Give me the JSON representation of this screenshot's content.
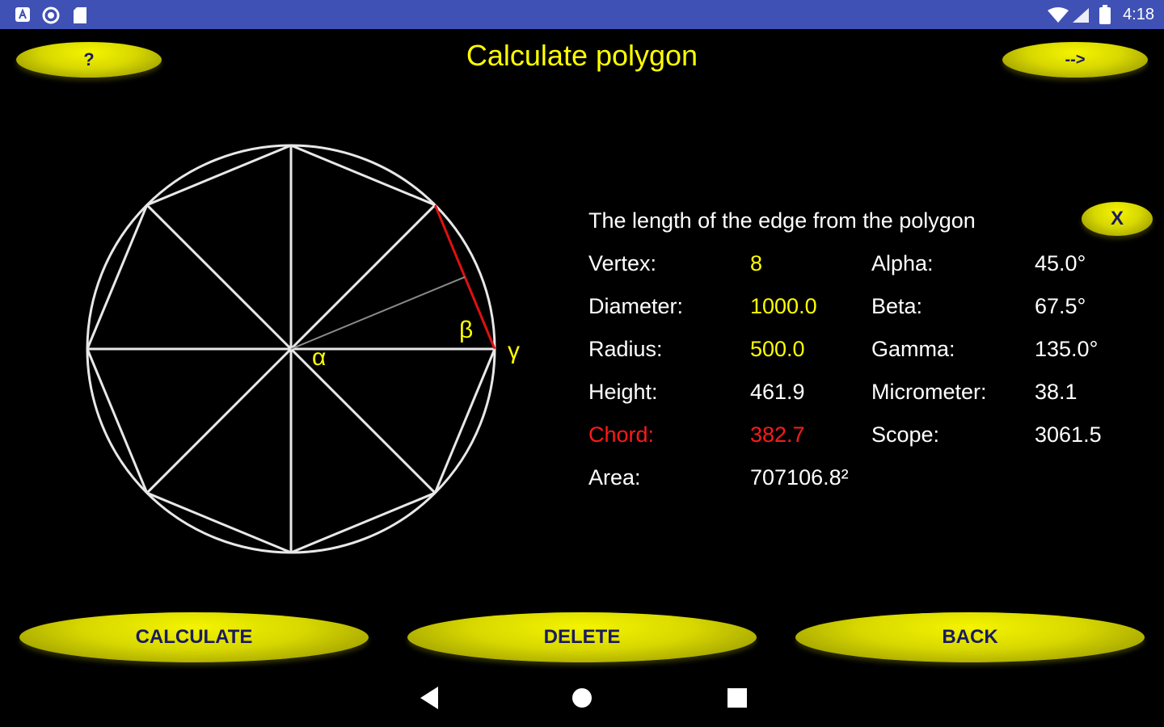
{
  "status_bar": {
    "time": "4:18",
    "left_icons": [
      "accessibility-icon",
      "circle-icon",
      "sd-card-icon"
    ],
    "right_icons": [
      "wifi-icon",
      "signal-icon",
      "battery-icon"
    ]
  },
  "header": {
    "title": "Calculate polygon",
    "help_label": "?",
    "next_label": "-->"
  },
  "diagram": {
    "vertex_count": 8,
    "angle_labels": {
      "alpha": "α",
      "beta": "β",
      "gamma": "γ"
    },
    "colors": {
      "lines": "#e8e8e8",
      "chord": "#e01010",
      "height_line": "#8a8a8a",
      "greek": "#ffff00"
    }
  },
  "info": {
    "heading": "The length of the edge from the polygon",
    "close_label": "X",
    "left": [
      {
        "label": "Vertex:",
        "value": "8",
        "style": "yellow"
      },
      {
        "label": "Diameter:",
        "value": "1000.0",
        "style": "yellow"
      },
      {
        "label": "Radius:",
        "value": "500.0",
        "style": "yellow"
      },
      {
        "label": "Height:",
        "value": "461.9",
        "style": "white"
      },
      {
        "label": "Chord:",
        "value": "382.7",
        "style": "red"
      },
      {
        "label": "Area:",
        "value": "707106.8²",
        "style": "white"
      }
    ],
    "right": [
      {
        "label": "Alpha:",
        "value": "45.0°"
      },
      {
        "label": "Beta:",
        "value": "67.5°"
      },
      {
        "label": "Gamma:",
        "value": "135.0°"
      },
      {
        "label": "Micrometer:",
        "value": "38.1"
      },
      {
        "label": "Scope:",
        "value": "3061.5"
      }
    ]
  },
  "actions": {
    "calculate": "CALCULATE",
    "delete": "DELETE",
    "back": "BACK"
  },
  "nav_bar": {
    "back_icon": "back-triangle-icon",
    "home_icon": "home-circle-icon",
    "recents_icon": "recents-square-icon"
  },
  "colors": {
    "status_bar": "#3f51b5",
    "background": "#000000",
    "accent_yellow": "#ffff00",
    "button_text": "#1a1a60",
    "highlight_red": "#ff1a1a"
  }
}
